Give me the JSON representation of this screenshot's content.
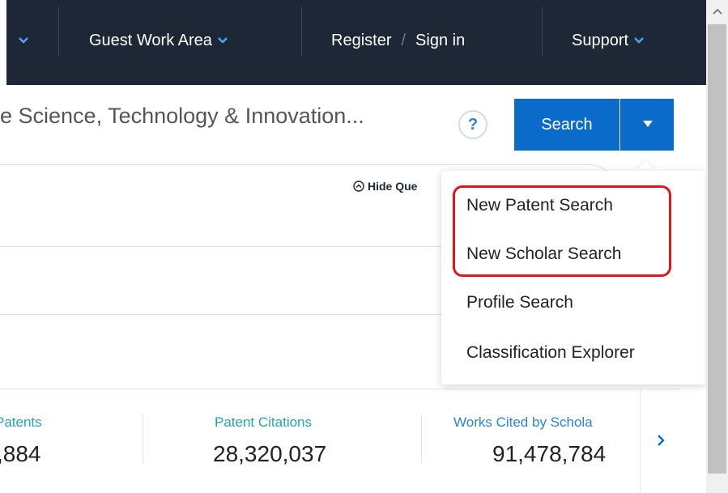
{
  "nav": {
    "guest_work_area": "Guest Work Area",
    "register": "Register",
    "separator": "/",
    "sign_in": "Sign in",
    "support": "Support"
  },
  "search": {
    "query_text": "e Science, Technology & Innovation...",
    "help": "?",
    "button_label": "Search"
  },
  "query_panel": {
    "hide_query": "Hide Que"
  },
  "dropdown": {
    "items": [
      "New Patent Search",
      "New Scholar Search",
      "Profile Search",
      "Classification Explorer"
    ]
  },
  "stats": [
    {
      "label": "Patents",
      "value": ",884"
    },
    {
      "label": "Patent Citations",
      "value": "28,320,037"
    },
    {
      "label": "Works Cited by Schola",
      "value": "91,478,784"
    }
  ],
  "colors": {
    "nav_bg": "#1d2735",
    "primary": "#0b6bcb",
    "stat_label": "#2aa3a8",
    "highlight": "#e4141b"
  },
  "icons": {
    "chevron": "chevron-down-icon",
    "caret": "caret-down-icon",
    "hide_query": "chevron-up-circle-icon",
    "next": "chevron-right-icon",
    "scroll_up": "scroll-up-arrow-icon"
  }
}
